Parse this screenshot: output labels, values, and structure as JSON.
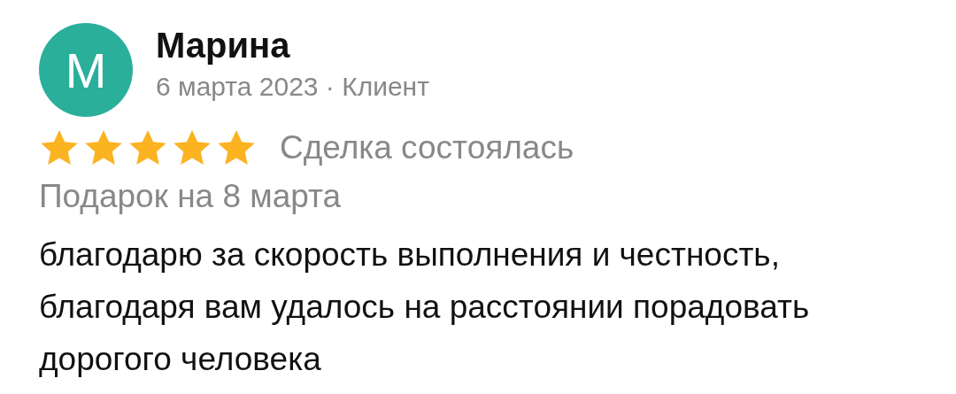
{
  "review": {
    "avatar_letter": "М",
    "author": "Марина",
    "meta": "6 марта 2023 · Клиент",
    "stars": 5,
    "deal_status": "Сделка состоялась",
    "subject": "Подарок на 8 марта",
    "text": "благодарю за скорость выполнения и честность, благодаря вам удалось на расстоянии порадовать дорогого человека"
  }
}
